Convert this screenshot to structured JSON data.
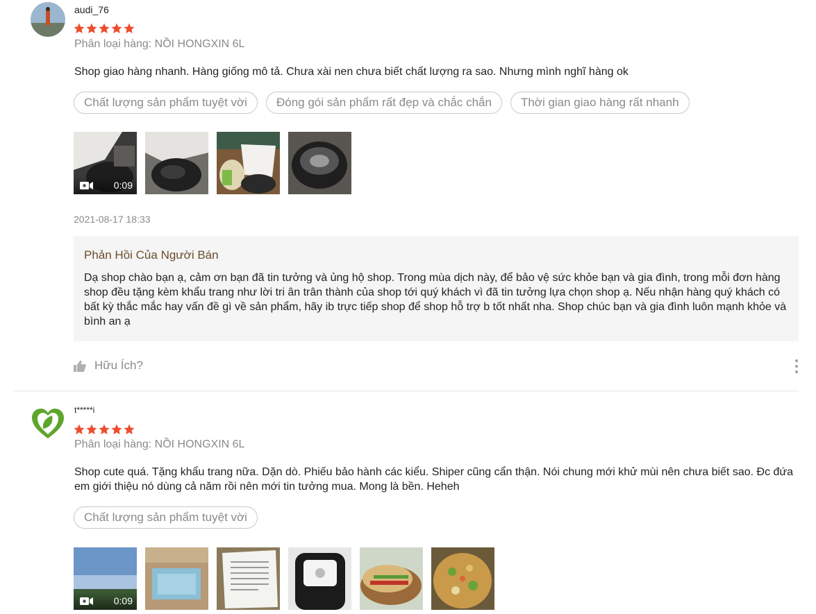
{
  "reviews": [
    {
      "username": "audi_76",
      "rating": 5,
      "variation": "Phân loại hàng: NỒI HONGXIN 6L",
      "comment": "Shop giao hàng nhanh. Hàng giống mô tả. Chưa xài nen chưa biết chất lượng ra sao. Nhưng mình nghĩ hàng ok",
      "tags": [
        "Chất lượng sản phẩm tuyệt vời",
        "Đóng gói sản phẩm rất đẹp và chắc chắn",
        "Thời gian giao hàng rất nhanh"
      ],
      "video_duration": "0:09",
      "time": "2021-08-17 18:33",
      "seller_reply": {
        "title": "Phản Hồi Của Người Bán",
        "text": "Dạ shop chào bạn ạ, cảm ơn bạn đã tin tưởng và ủng hộ shop. Trong mùa dịch này, để bảo vệ sức khỏe bạn và gia đình, trong mỗi đơn hàng shop đều tặng kèm khẩu trang như lời tri ân trân thành của shop tới quý khách vì đã tin tưởng lựa chọn shop ạ. Nếu nhận hàng quý khách có bất kỳ thắc mắc hay vấn đề gì về sản phẩm, hãy ib trực tiếp shop để shop hỗ trợ b tốt nhất nha. Shop chúc bạn và gia đình luôn mạnh khỏe và bình an ạ"
      },
      "helpful_label": "Hữu Ích?"
    },
    {
      "username": "t*****i",
      "rating": 5,
      "variation": "Phân loại hàng: NỒI HONGXIN 6L",
      "comment": "Shop cute quá. Tặng khẩu trang nữa. Dặn dò. Phiếu bảo hành các kiểu. Shiper cũng cẩn thận. Nói chung mới khử mùi nên chưa biết sao. Đc đứa em giới thiệu nó dùng cả năm rồi nên mới tin tưởng mua. Mong là bền. Heheh",
      "tags": [
        "Chất lượng sản phẩm tuyệt vời"
      ],
      "video_duration": "0:09"
    }
  ],
  "colors": {
    "star": "#ee4d2d",
    "reply_title": "#6b4d2c",
    "muted": "#8a8a8a"
  }
}
